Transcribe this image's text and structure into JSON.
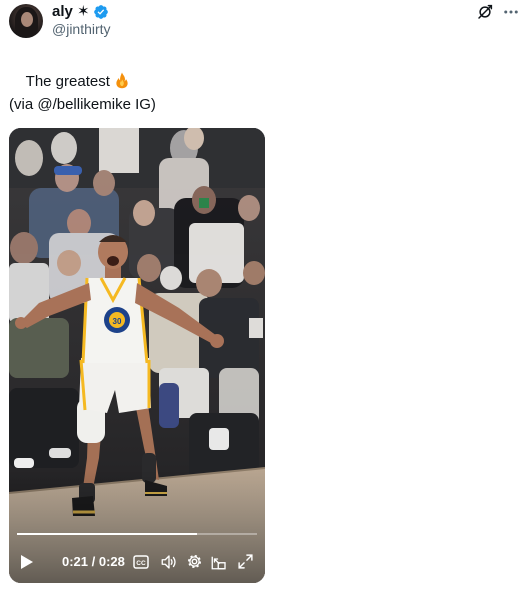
{
  "author": {
    "display_name": "aly ✶",
    "handle": "@jinthirty",
    "verified": true
  },
  "tweet": {
    "line1": "The greatest",
    "line1_emoji": "fire-icon",
    "line2": "(via @/bellikemike IG)"
  },
  "video": {
    "time_display": "0:21 / 0:28",
    "progress_fraction": 0.75,
    "controls": [
      "play-icon",
      "captions-icon",
      "volume-icon",
      "settings-icon",
      "pip-icon",
      "fullscreen-icon"
    ]
  },
  "colors": {
    "verified_blue": "#1d9bf0",
    "text_primary": "#0f1419",
    "text_secondary": "#536471",
    "jersey_white": "#f5f5f2",
    "jersey_gold": "#f5b922",
    "jersey_blue": "#1d428a"
  }
}
